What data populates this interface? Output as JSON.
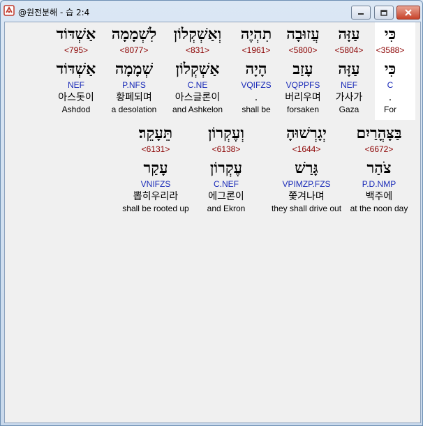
{
  "window": {
    "title": "@원전분해 - 습 2:4"
  },
  "rows": [
    {
      "words": [
        {
          "hebrew": "אַשְׁדּוֹד",
          "strong": "<795>",
          "lemma": "אַשְׁדּוֹד",
          "morph": "NEF",
          "korean": "아스돗이",
          "english": "Ashdod"
        },
        {
          "hebrew": "לִשְׁמָמָה",
          "strong": "<8077>",
          "lemma": "שְׁמָמָה",
          "morph": "P.NFS",
          "korean": "황폐되며",
          "english": "a desolation"
        },
        {
          "hebrew": "וְאַשְׁקְלוֹן",
          "strong": "<831>",
          "lemma": "אַשְׁקְלוֹן",
          "morph": "C.NE",
          "korean": "아스글론이",
          "english": "and Ashkelon"
        },
        {
          "hebrew": "תִהְיֶה",
          "strong": "<1961>",
          "lemma": "הָיָה",
          "morph": "VQIFZS",
          "korean": ".",
          "english": "shall be"
        },
        {
          "hebrew": "עֲזוּבָה",
          "strong": "<5800>",
          "lemma": "עָזַב",
          "morph": "VQPPFS",
          "korean": "버리우며",
          "english": "forsaken"
        },
        {
          "hebrew": "עַזָּה",
          "strong": "<5804>",
          "lemma": "עַזָּה",
          "morph": "NEF",
          "korean": "가사가",
          "english": "Gaza"
        },
        {
          "hebrew": "כִּי",
          "strong": "<3588>",
          "lemma": "כִּי",
          "morph": "C",
          "korean": ".",
          "english": "For"
        }
      ]
    },
    {
      "words": [
        {
          "hebrew": "תֵּעָקֵר׃",
          "strong": "<6131>",
          "lemma": "עָקַר",
          "morph": "VNIFZS",
          "korean": "뽑히우리라",
          "english": "shall be rooted up"
        },
        {
          "hebrew": "וְעֶקְרוֹן",
          "strong": "<6138>",
          "lemma": "עֶקְרוֹן",
          "morph": "C.NEF",
          "korean": "에그론이",
          "english": "and Ekron"
        },
        {
          "hebrew": "יְגָרְשׁוּהָ",
          "strong": "<1644>",
          "lemma": "גָּרַשׁ",
          "morph": "VPIMZP.FZS",
          "korean": "쫓겨나며",
          "english": "they shall drive out"
        },
        {
          "hebrew": "בַּצָּהֳרַיִם",
          "strong": "<6672>",
          "lemma": "צֹהַר",
          "morph": "P.D.NMP",
          "korean": "백주에",
          "english": "at the noon day"
        }
      ]
    }
  ]
}
